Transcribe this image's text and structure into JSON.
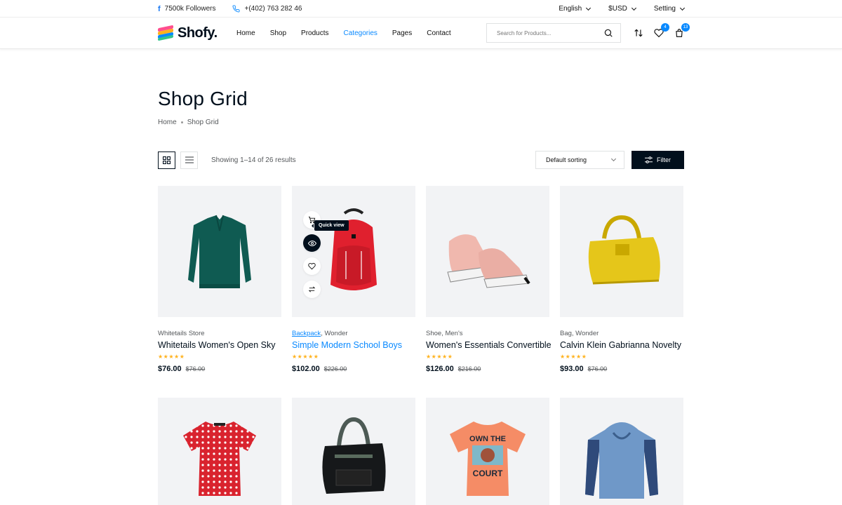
{
  "topbar": {
    "followers": "7500k Followers",
    "phone": "+(402) 763 282 46",
    "language": "English",
    "currency": "$USD",
    "setting": "Setting"
  },
  "header": {
    "logo": "Shofy.",
    "nav": [
      "Home",
      "Shop",
      "Products",
      "Categories",
      "Pages",
      "Contact"
    ],
    "active_nav": "Categories",
    "search_placeholder": "Search for Products...",
    "wishlist_count": "4",
    "cart_count": "13"
  },
  "page": {
    "title": "Shop Grid",
    "breadcrumb": [
      "Home",
      "Shop Grid"
    ]
  },
  "toolbar": {
    "results": "Showing 1–14 of 26 results",
    "sorting": "Default sorting",
    "filter": "Filter"
  },
  "quick_view_label": "Quick view",
  "products": [
    {
      "meta": "Whitetails Store",
      "title": "Whitetails Women's Open Sky",
      "price": "$76.00",
      "old_price": "$76.00",
      "rating": 5,
      "image": "green-henley-shirt"
    },
    {
      "meta_link": "Backpack",
      "meta_rest": ", Wonder",
      "title": "Simple Modern School Boys",
      "price": "$102.00",
      "old_price": "$226.00",
      "rating": 5,
      "image": "red-backpack"
    },
    {
      "meta": "Shoe, Men's",
      "title": "Women's Essentials Convertible",
      "price": "$126.00",
      "old_price": "$216.00",
      "rating": 5,
      "image": "pink-sneakers"
    },
    {
      "meta": "Bag, Wonder",
      "title": "Calvin Klein Gabrianna Novelty",
      "price": "$93.00",
      "old_price": "$76.00",
      "rating": 5,
      "image": "yellow-handbag"
    },
    {
      "image": "red-polka-dot-tee"
    },
    {
      "image": "black-tote-bag"
    },
    {
      "image": "orange-graphic-tee",
      "graphic_text": [
        "OWN THE",
        "COURT"
      ]
    },
    {
      "image": "blue-hoodie"
    }
  ],
  "colors": {
    "accent": "#0989ff",
    "dark": "#010f1c",
    "star": "#ffb21d",
    "card_bg": "#f2f3f5"
  }
}
